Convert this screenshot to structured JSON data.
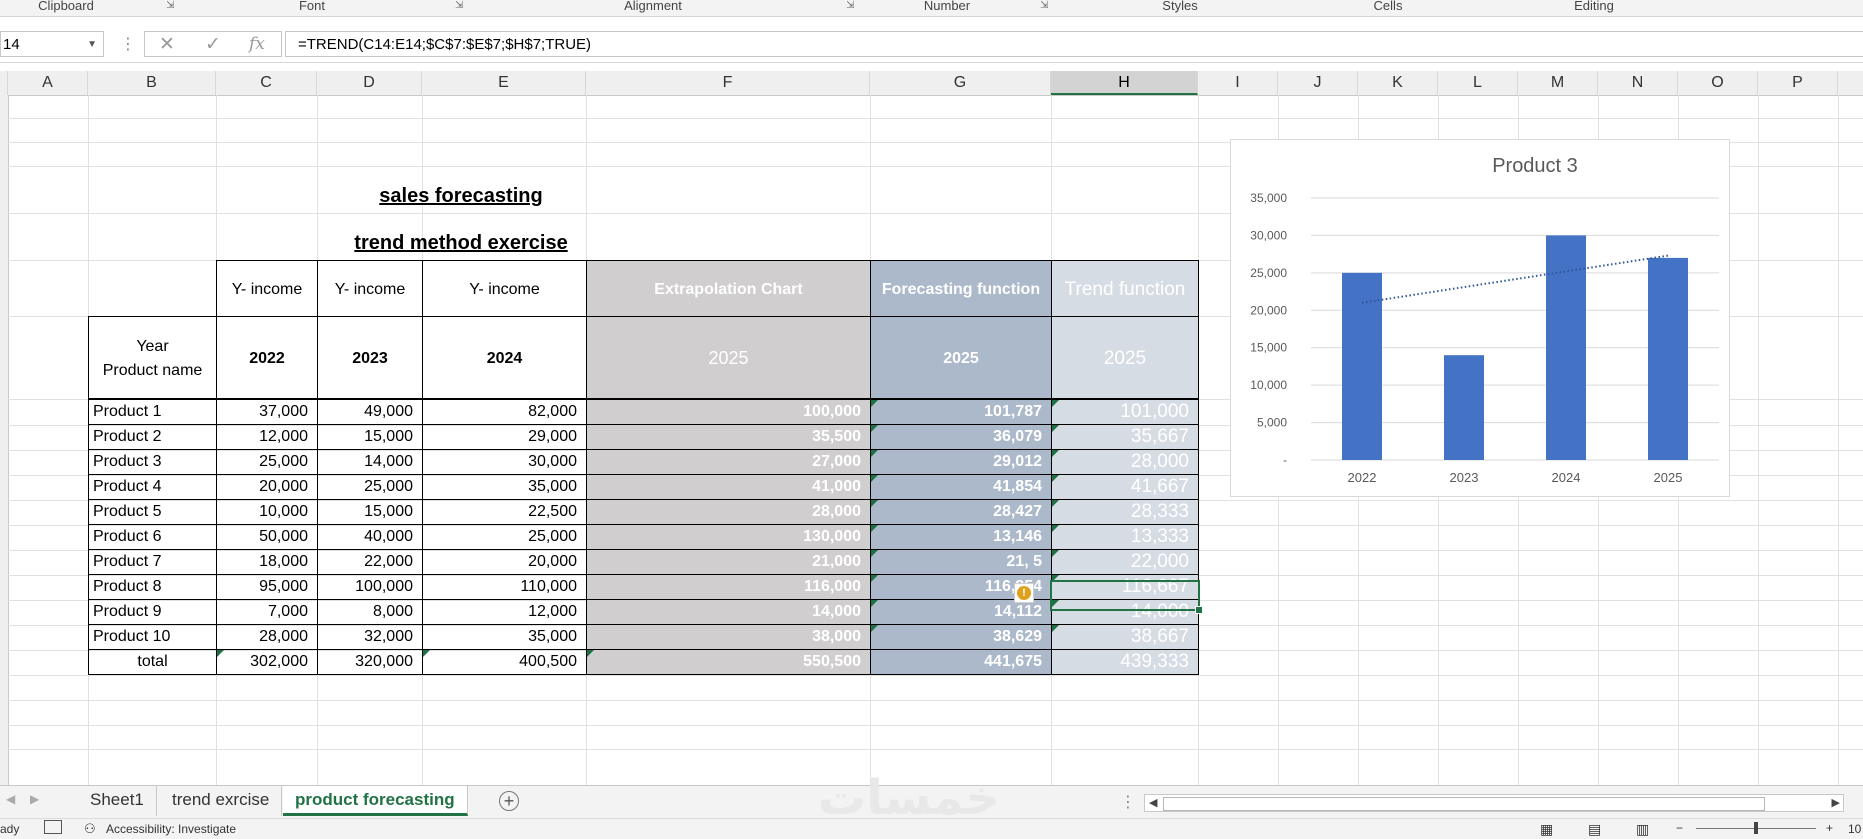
{
  "ribbon": {
    "groups": [
      {
        "label": "Clipboard"
      },
      {
        "label": "Font"
      },
      {
        "label": "Alignment"
      },
      {
        "label": "Number"
      },
      {
        "label": "Styles"
      },
      {
        "label": "Cells"
      },
      {
        "label": "Editing"
      }
    ]
  },
  "formula_bar": {
    "name_box": "14",
    "formula": "=TREND(C14:E14;$C$7:$E$7;$H$7;TRUE)"
  },
  "columns": [
    "A",
    "B",
    "C",
    "D",
    "E",
    "F",
    "G",
    "H",
    "I",
    "J",
    "K",
    "L",
    "M",
    "N",
    "O",
    "P"
  ],
  "selected_column": "H",
  "titles": {
    "main": "sales forecasting",
    "sub": "trend method exercise"
  },
  "table": {
    "header_income": "Y- income",
    "header_year_line1": "Year",
    "header_year_line2": "Product name",
    "years": [
      "2022",
      "2023",
      "2024"
    ],
    "method_headers": [
      "Extrapolation Chart",
      "Forecasting function",
      "Trend function"
    ],
    "forecast_year": "2025",
    "rows": [
      {
        "name": "Product 1",
        "y2022": "37,000",
        "y2023": "49,000",
        "y2024": "82,000",
        "extrap": "100,000",
        "forecast": "101,787",
        "trend": "101,000"
      },
      {
        "name": "Product 2",
        "y2022": "12,000",
        "y2023": "15,000",
        "y2024": "29,000",
        "extrap": "35,500",
        "forecast": "36,079",
        "trend": "35,667"
      },
      {
        "name": "Product 3",
        "y2022": "25,000",
        "y2023": "14,000",
        "y2024": "30,000",
        "extrap": "27,000",
        "forecast": "29,012",
        "trend": "28,000"
      },
      {
        "name": "Product 4",
        "y2022": "20,000",
        "y2023": "25,000",
        "y2024": "35,000",
        "extrap": "41,000",
        "forecast": "41,854",
        "trend": "41,667"
      },
      {
        "name": "Product 5",
        "y2022": "10,000",
        "y2023": "15,000",
        "y2024": "22,500",
        "extrap": "28,000",
        "forecast": "28,427",
        "trend": "28,333"
      },
      {
        "name": "Product 6",
        "y2022": "50,000",
        "y2023": "40,000",
        "y2024": "25,000",
        "extrap": "130,000",
        "forecast": "13,146",
        "trend": "13,333"
      },
      {
        "name": "Product 7",
        "y2022": "18,000",
        "y2023": "22,000",
        "y2024": "20,000",
        "extrap": "21,000",
        "forecast": "21,  5",
        "trend": "22,000"
      },
      {
        "name": "Product 8",
        "y2022": "95,000",
        "y2023": "100,000",
        "y2024": "110,000",
        "extrap": "116,000",
        "forecast": "116,854",
        "trend": "116,667"
      },
      {
        "name": "Product 9",
        "y2022": "7,000",
        "y2023": "8,000",
        "y2024": "12,000",
        "extrap": "14,000",
        "forecast": "14,112",
        "trend": "14,000"
      },
      {
        "name": "Product 10",
        "y2022": "28,000",
        "y2023": "32,000",
        "y2024": "35,000",
        "extrap": "38,000",
        "forecast": "38,629",
        "trend": "38,667"
      }
    ],
    "total": {
      "name": "total",
      "y2022": "302,000",
      "y2023": "320,000",
      "y2024": "400,500",
      "extrap": "550,500",
      "forecast": "441,675",
      "trend": "439,333"
    }
  },
  "colors": {
    "extrap_fill": "#d0cece",
    "forecast_fill": "#acb9ca",
    "trend_fill": "#d6dce4",
    "excel_green": "#217346",
    "bar_color": "#4472c4"
  },
  "chart_data": {
    "type": "bar",
    "title": "Product 3",
    "categories": [
      "2022",
      "2023",
      "2024",
      "2025"
    ],
    "values": [
      25000,
      14000,
      30000,
      27000
    ],
    "ylim": [
      0,
      35000
    ],
    "yticks": [
      0,
      5000,
      10000,
      15000,
      20000,
      25000,
      30000,
      35000
    ],
    "ytick_labels": [
      "-",
      "5,000",
      "10,000",
      "15,000",
      "20,000",
      "25,000",
      "30,000",
      "35,000"
    ],
    "trendline": {
      "type": "linear",
      "style": "dotted",
      "start": 21000,
      "end": 27300
    },
    "grid": true,
    "legend": "none"
  },
  "sheet_tabs": [
    "Sheet1",
    "trend exrcise",
    "product forecasting"
  ],
  "active_tab": "product forecasting",
  "watermark": "خمسات",
  "status": {
    "ready": "ady",
    "accessibility": "Accessibility: Investigate",
    "zoom": "10"
  },
  "icons": {
    "cancel": "✕",
    "enter": "✓",
    "fx": "fx",
    "warning": "!"
  }
}
